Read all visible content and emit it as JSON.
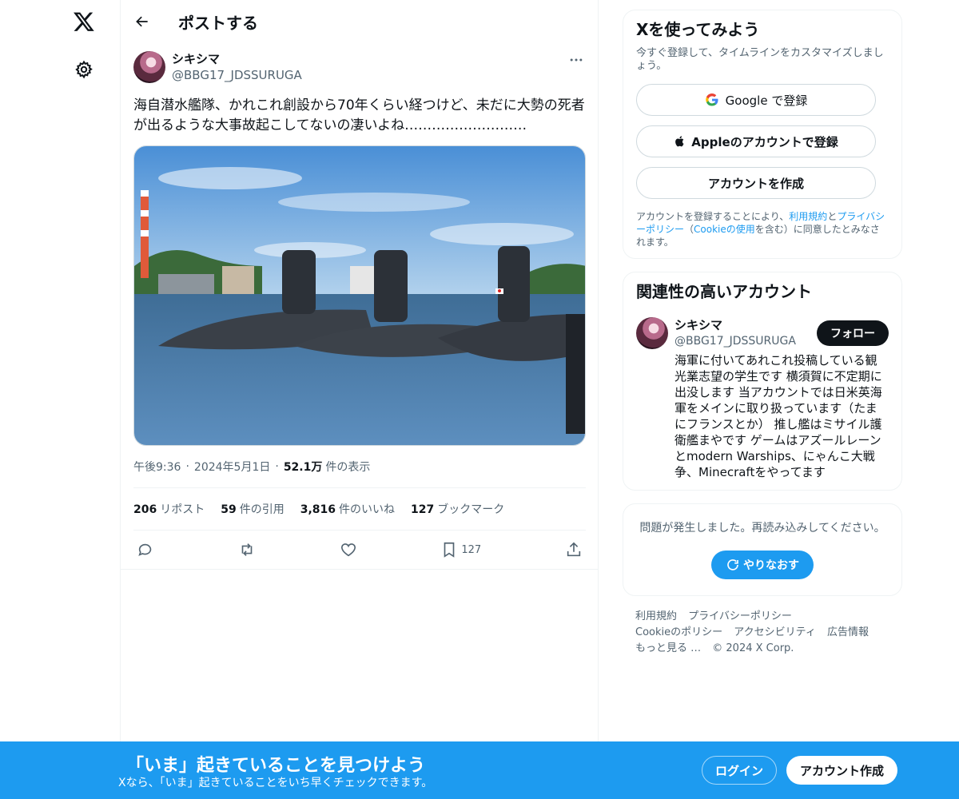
{
  "page": {
    "title": "ポストする"
  },
  "post": {
    "author_name": "シキシマ",
    "author_handle": "@BBG17_JDSSURUGA",
    "text": "海自潜水艦隊、かれこれ創設から70年くらい経つけど、未だに大勢の死者が出るような大事故起こしてないの凄いよね………………………",
    "time": "午後9:36",
    "date": "2024年5月1日",
    "views_count": "52.1万",
    "views_label": "件の表示",
    "stats": {
      "reposts_count": "206",
      "reposts_label": "リポスト",
      "quotes_count": "59",
      "quotes_label": "件の引用",
      "likes_count": "3,816",
      "likes_label": "件のいいね",
      "bookmarks_count": "127",
      "bookmarks_label": "ブックマーク"
    },
    "bookmark_action_count": "127"
  },
  "signup": {
    "title": "Xを使ってみよう",
    "subtitle": "今すぐ登録して、タイムラインをカスタマイズしましょう。",
    "google_label": "Google で登録",
    "apple_label": "Appleのアカウントで登録",
    "create_label": "アカウントを作成",
    "terms_prefix": "アカウントを登録することにより、",
    "terms_link": "利用規約",
    "terms_and": "と",
    "privacy_link": "プライバシーポリシー",
    "terms_mid": "（",
    "cookie_link": "Cookieの使用",
    "terms_suffix": "を含む）に同意したとみなされます。"
  },
  "related": {
    "title": "関連性の高いアカウント",
    "name": "シキシマ",
    "handle": "@BBG17_JDSSURUGA",
    "follow_label": "フォロー",
    "bio": "海軍に付いてあれこれ投稿している観光業志望の学生です 横須賀に不定期に出没します 当アカウントでは日米英海軍をメインに取り扱っています（たまにフランスとか） 推し艦はミサイル護衛艦まやです ゲームはアズールレーンとmodern Warships、にゃんこ大戦争、Minecraftをやってます"
  },
  "error": {
    "message": "問題が発生しました。再読み込みしてください。",
    "retry_label": "やりなおす"
  },
  "footer": {
    "links": [
      "利用規約",
      "プライバシーポリシー",
      "Cookieのポリシー",
      "アクセシビリティ",
      "広告情報",
      "もっと見る …",
      "© 2024 X Corp."
    ]
  },
  "banner": {
    "title": "「いま」起きていることを見つけよう",
    "subtitle": "Xなら、「いま」起きていることをいち早くチェックできます。",
    "login_label": "ログイン",
    "create_label": "アカウント作成"
  },
  "colors": {
    "accent": "#1d9bf0",
    "text": "#0f1419",
    "muted": "#536471",
    "border": "#eff3f4"
  },
  "icons": [
    "x-logo-icon",
    "gear-icon",
    "back-arrow-icon",
    "more-icon",
    "reply-icon",
    "repost-icon",
    "like-icon",
    "bookmark-icon",
    "share-icon",
    "google-icon",
    "apple-icon",
    "refresh-icon"
  ]
}
